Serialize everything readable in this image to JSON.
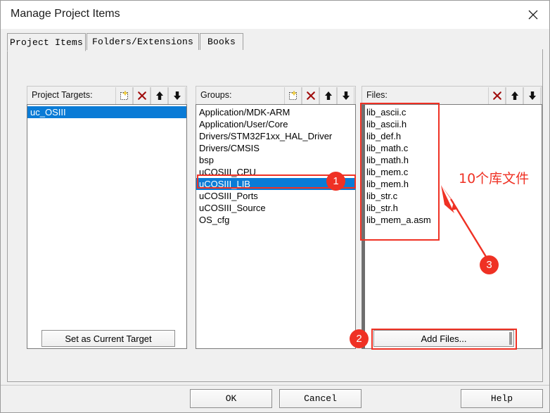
{
  "window": {
    "title": "Manage Project Items",
    "close_icon": "close-icon"
  },
  "tabs": [
    {
      "label": "Project Items",
      "selected": true
    },
    {
      "label": "Folders/Extensions",
      "selected": false
    },
    {
      "label": "Books",
      "selected": false
    }
  ],
  "panels": {
    "project_targets": {
      "label": "Project Targets:",
      "toolbar": [
        {
          "icon": "new-item-icon",
          "name": "new-target-button"
        },
        {
          "icon": "delete-x-icon",
          "name": "delete-target-button"
        },
        {
          "icon": "arrow-up-icon",
          "name": "move-target-up-button"
        },
        {
          "icon": "arrow-down-icon",
          "name": "move-target-down-button"
        }
      ],
      "items": [
        {
          "label": "uc_OSIII",
          "selected": true
        }
      ]
    },
    "groups": {
      "label": "Groups:",
      "toolbar": [
        {
          "icon": "new-item-icon",
          "name": "new-group-button"
        },
        {
          "icon": "delete-x-icon",
          "name": "delete-group-button"
        },
        {
          "icon": "arrow-up-icon",
          "name": "move-group-up-button"
        },
        {
          "icon": "arrow-down-icon",
          "name": "move-group-down-button"
        }
      ],
      "items": [
        {
          "label": "Application/MDK-ARM",
          "selected": false
        },
        {
          "label": "Application/User/Core",
          "selected": false
        },
        {
          "label": "Drivers/STM32F1xx_HAL_Driver",
          "selected": false
        },
        {
          "label": "Drivers/CMSIS",
          "selected": false
        },
        {
          "label": "bsp",
          "selected": false
        },
        {
          "label": "uCOSIII_CPU",
          "selected": false
        },
        {
          "label": "uCOSIII_LIB",
          "selected": true
        },
        {
          "label": "uCOSIII_Ports",
          "selected": false
        },
        {
          "label": "uCOSIII_Source",
          "selected": false
        },
        {
          "label": "OS_cfg",
          "selected": false
        }
      ]
    },
    "files": {
      "label": "Files:",
      "toolbar": [
        {
          "icon": "delete-x-icon",
          "name": "delete-file-button"
        },
        {
          "icon": "arrow-up-icon",
          "name": "move-file-up-button"
        },
        {
          "icon": "arrow-down-icon",
          "name": "move-file-down-button"
        }
      ],
      "items": [
        {
          "label": "lib_ascii.c",
          "selected": false
        },
        {
          "label": "lib_ascii.h",
          "selected": false
        },
        {
          "label": "lib_def.h",
          "selected": false
        },
        {
          "label": "lib_math.c",
          "selected": false
        },
        {
          "label": "lib_math.h",
          "selected": false
        },
        {
          "label": "lib_mem.c",
          "selected": false
        },
        {
          "label": "lib_mem.h",
          "selected": false
        },
        {
          "label": "lib_str.c",
          "selected": false
        },
        {
          "label": "lib_str.h",
          "selected": false
        },
        {
          "label": "lib_mem_a.asm",
          "selected": false
        }
      ]
    }
  },
  "buttons": {
    "set_as_current_target": "Set as Current Target",
    "add_files": "Add Files...",
    "ok": "OK",
    "cancel": "Cancel",
    "help": "Help"
  },
  "annotations": {
    "color": "#EF3124",
    "badge_1": "1",
    "badge_2": "2",
    "badge_3": "3",
    "note_text": "10个库文件"
  }
}
